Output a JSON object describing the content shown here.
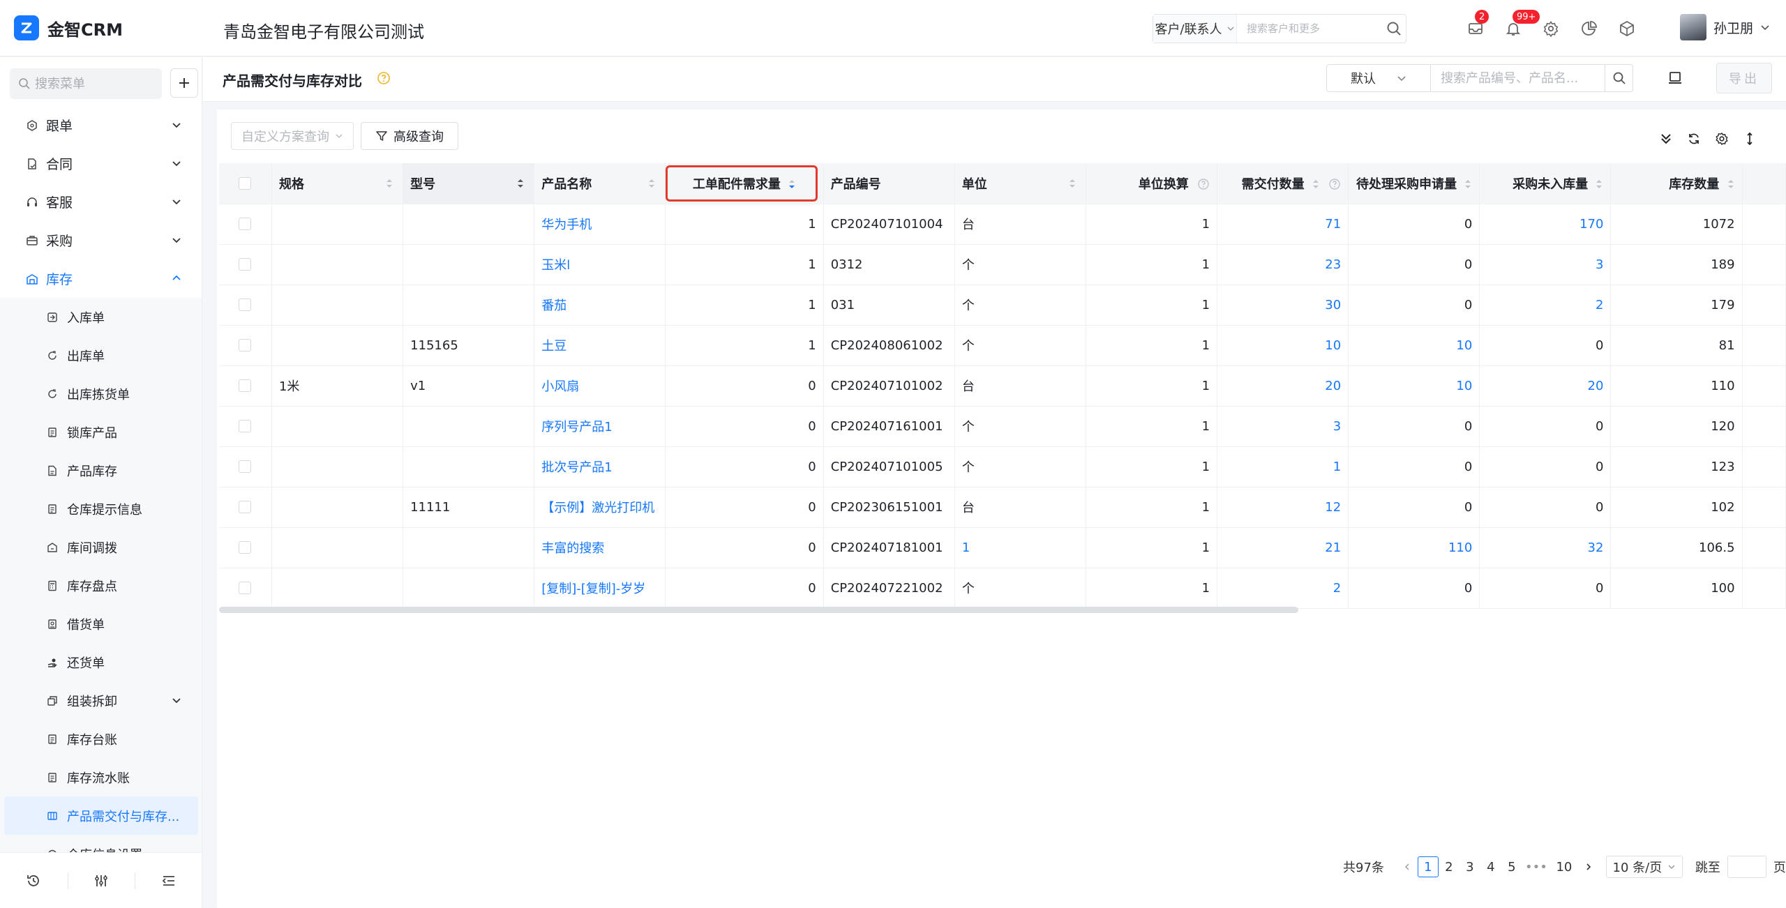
{
  "app": {
    "name": "金智CRM",
    "company": "青岛金智电子有限公司测试"
  },
  "top_search": {
    "type_label": "客户/联系人",
    "placeholder": "搜索客户和更多"
  },
  "notifications": {
    "mail_count": "2",
    "bell_count": "99+"
  },
  "user": {
    "name": "孙卫朋"
  },
  "sidebar": {
    "search_placeholder": "搜索菜单",
    "menu": [
      {
        "label": "跟单",
        "icon": "hexagon-icon"
      },
      {
        "label": "合同",
        "icon": "contract-icon"
      },
      {
        "label": "客服",
        "icon": "headset-icon"
      },
      {
        "label": "采购",
        "icon": "briefcase-icon"
      },
      {
        "label": "库存",
        "icon": "warehouse-icon"
      }
    ],
    "sub_items": [
      {
        "label": "入库单"
      },
      {
        "label": "出库单"
      },
      {
        "label": "出库拣货单"
      },
      {
        "label": "锁库产品"
      },
      {
        "label": "产品库存"
      },
      {
        "label": "仓库提示信息"
      },
      {
        "label": "库间调拨"
      },
      {
        "label": "库存盘点"
      },
      {
        "label": "借货单"
      },
      {
        "label": "还货单"
      },
      {
        "label": "组装拆卸"
      },
      {
        "label": "库存台账"
      },
      {
        "label": "库存流水账"
      },
      {
        "label": "产品需交付与库存..."
      },
      {
        "label": "仓库信息设置"
      }
    ]
  },
  "page": {
    "title": "产品需交付与库存对比",
    "view_label": "默认",
    "search_placeholder": "搜索产品编号、产品名...",
    "export_label": "导出"
  },
  "toolbar": {
    "custom_query_placeholder": "自定义方案查询",
    "advanced_query_label": "高级查询"
  },
  "table": {
    "columns": [
      "规格",
      "型号",
      "产品名称",
      "工单配件需求量",
      "产品编号",
      "单位",
      "单位换算",
      "需交付数量",
      "待处理采购申请量",
      "采购未入库量",
      "库存数量"
    ],
    "rows": [
      {
        "spec": "",
        "model": "",
        "name": "华为手机",
        "demand": "1",
        "code": "CP202407101004",
        "unit": "台",
        "conv": "1",
        "deliver": "71",
        "pending": "0",
        "unstocked": "170",
        "stock": "1072"
      },
      {
        "spec": "",
        "model": "",
        "name": "玉米l",
        "demand": "1",
        "code": "0312",
        "unit": "个",
        "conv": "1",
        "deliver": "23",
        "pending": "0",
        "unstocked": "3",
        "stock": "189"
      },
      {
        "spec": "",
        "model": "",
        "name": "番茄",
        "demand": "1",
        "code": "031",
        "unit": "个",
        "conv": "1",
        "deliver": "30",
        "pending": "0",
        "unstocked": "2",
        "stock": "179"
      },
      {
        "spec": "",
        "model": "115165",
        "name": "土豆",
        "demand": "1",
        "code": "CP202408061002",
        "unit": "个",
        "conv": "1",
        "deliver": "10",
        "pending": "10",
        "unstocked": "0",
        "stock": "81"
      },
      {
        "spec": "1米",
        "model": "v1",
        "name": "小风扇",
        "demand": "0",
        "code": "CP202407101002",
        "unit": "台",
        "conv": "1",
        "deliver": "20",
        "pending": "10",
        "unstocked": "20",
        "stock": "110"
      },
      {
        "spec": "",
        "model": "",
        "name": "序列号产品1",
        "demand": "0",
        "code": "CP202407161001",
        "unit": "个",
        "conv": "1",
        "deliver": "3",
        "pending": "0",
        "unstocked": "0",
        "stock": "120"
      },
      {
        "spec": "",
        "model": "",
        "name": "批次号产品1",
        "demand": "0",
        "code": "CP202407101005",
        "unit": "个",
        "conv": "1",
        "deliver": "1",
        "pending": "0",
        "unstocked": "0",
        "stock": "123"
      },
      {
        "spec": "",
        "model": "11111",
        "name": "【示例】激光打印机",
        "demand": "0",
        "code": "CP202306151001",
        "unit": "台",
        "conv": "1",
        "deliver": "12",
        "pending": "0",
        "unstocked": "0",
        "stock": "102"
      },
      {
        "spec": "",
        "model": "",
        "name": "丰富的搜索",
        "demand": "0",
        "code": "CP202407181001",
        "unit": "1",
        "conv": "1",
        "deliver": "21",
        "pending": "110",
        "unstocked": "32",
        "stock": "106.5"
      },
      {
        "spec": "",
        "model": "",
        "name": "[复制]-[复制]-岁岁",
        "demand": "0",
        "code": "CP202407221002",
        "unit": "个",
        "conv": "1",
        "deliver": "2",
        "pending": "0",
        "unstocked": "0",
        "stock": "100"
      }
    ]
  },
  "pagination": {
    "total": "共97条",
    "pages": [
      "1",
      "2",
      "3",
      "4",
      "5",
      "•••",
      "10"
    ],
    "current": "1",
    "page_size": "10 条/页",
    "jump_label": "跳至",
    "page_unit": "页"
  },
  "colors": {
    "primary": "#1677ff",
    "highlight_border": "#e23b2e",
    "badge": "#f5222d"
  }
}
